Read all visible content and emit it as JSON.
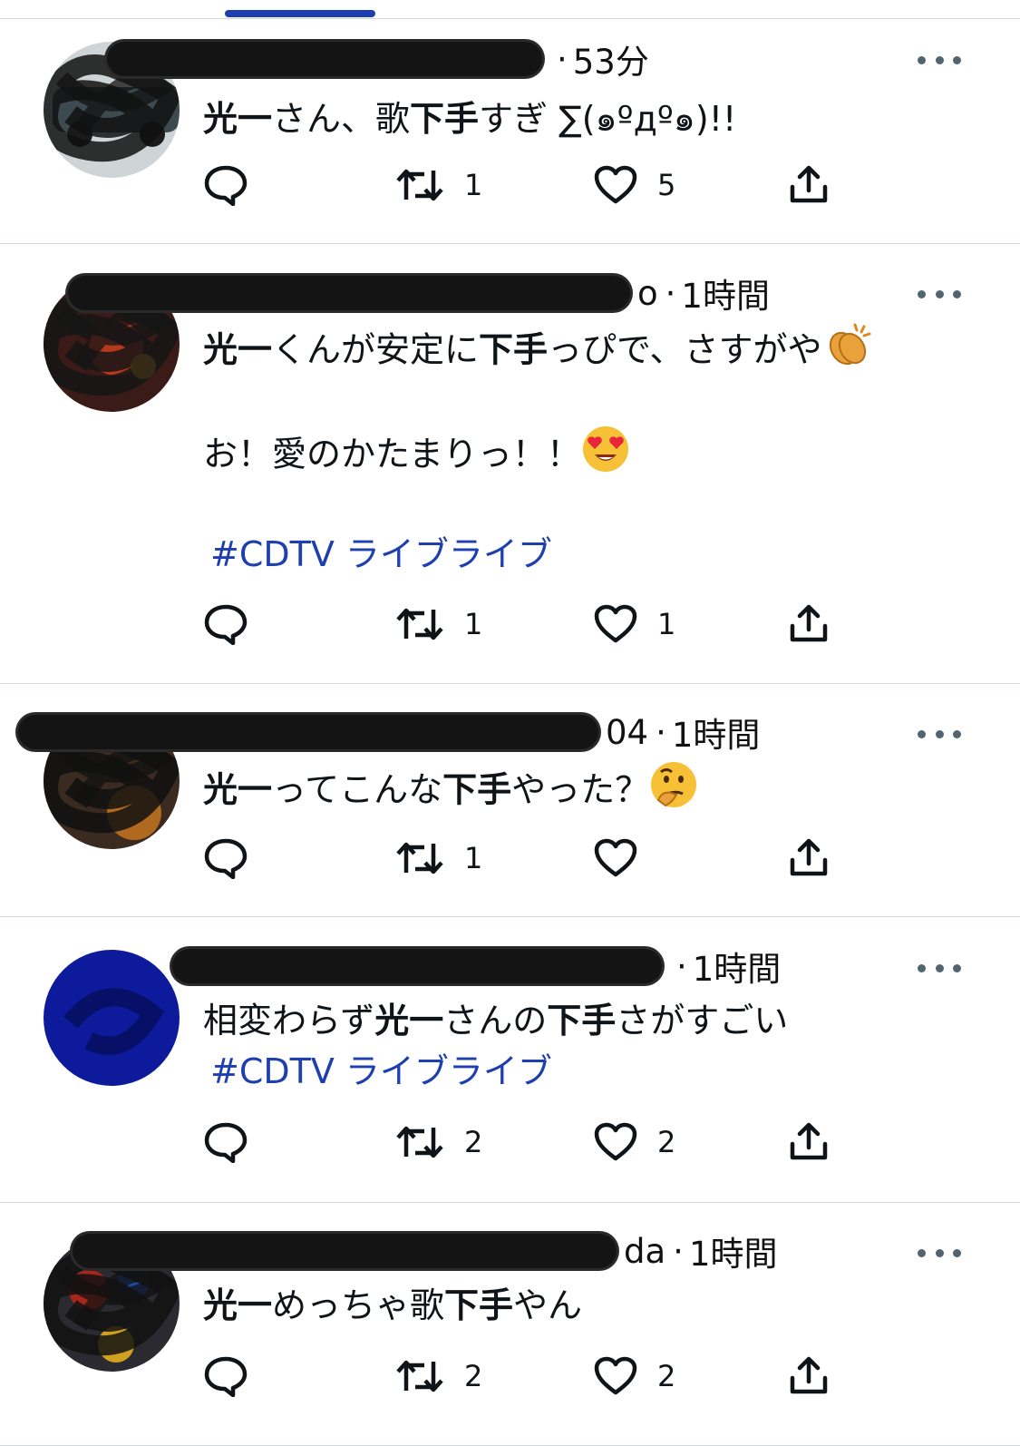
{
  "tweets": [
    {
      "handle_tail": "",
      "time": "53分",
      "lines": [
        [
          {
            "b": "光一"
          },
          {
            "t": "さん、歌"
          },
          {
            "b": "下手"
          },
          {
            "t": "すぎ ∑(๑ºдº๑)!!"
          }
        ]
      ],
      "retweets": "1",
      "likes": "5"
    },
    {
      "handle_tail": "o",
      "time": "1時間",
      "lines": [
        [
          {
            "b": "光一"
          },
          {
            "t": "くんが安定に"
          },
          {
            "b": "下手"
          },
          {
            "t": "っぴで、さすがや"
          },
          {
            "e": "clap"
          }
        ],
        [
          {
            "t": "お！愛のかたまりっ！！"
          },
          {
            "e": "heart-eyes"
          }
        ],
        [
          {
            "h": "#CDTV ライブライブ"
          }
        ]
      ],
      "retweets": "1",
      "likes": "1"
    },
    {
      "handle_tail": "04",
      "time": "1時間",
      "lines": [
        [
          {
            "b": "光一"
          },
          {
            "t": "ってこんな"
          },
          {
            "b": "下手"
          },
          {
            "t": "やった？"
          },
          {
            "e": "thinking"
          }
        ]
      ],
      "retweets": "1",
      "likes": ""
    },
    {
      "handle_tail": "",
      "time": "1時間",
      "lines": [
        [
          {
            "t": "相変わらず"
          },
          {
            "b": "光一"
          },
          {
            "t": "さんの"
          },
          {
            "b": "下手"
          },
          {
            "t": "さがすごい"
          }
        ],
        [
          {
            "h": "#CDTV ライブライブ"
          }
        ]
      ],
      "retweets": "2",
      "likes": "2"
    },
    {
      "handle_tail": "da",
      "time": "1時間",
      "lines": [
        [
          {
            "b": "光一"
          },
          {
            "t": "めっちゃ歌"
          },
          {
            "b": "下手"
          },
          {
            "t": "やん"
          }
        ]
      ],
      "retweets": "2",
      "likes": "2"
    }
  ],
  "icons": {
    "reply": "reply-icon",
    "retweet": "retweet-icon",
    "like": "heart-icon",
    "share": "share-icon",
    "more": "more-icon"
  },
  "colors": {
    "hashtag": "#1d3fb0",
    "tab_indicator": "#1d3fb0",
    "more_dots": "#536471"
  }
}
